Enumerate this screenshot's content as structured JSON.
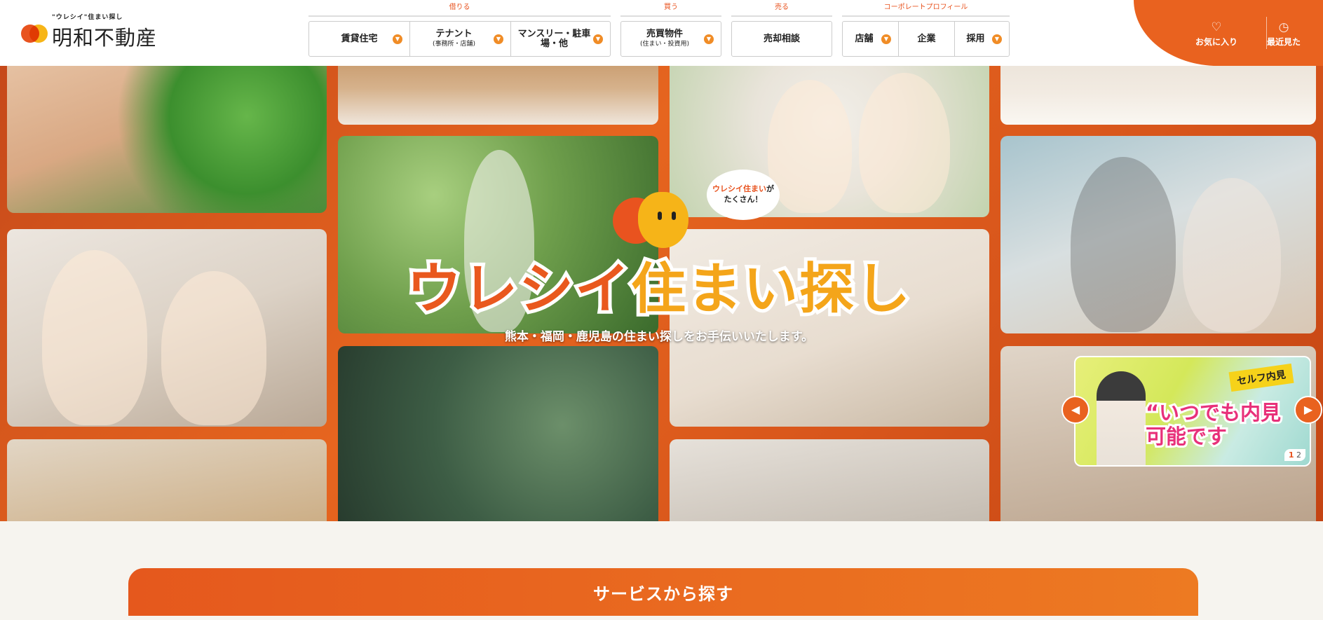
{
  "brand": {
    "tagline": "\"ウレシイ\"住まい探し",
    "name": "明和不動産",
    "accent": "#e9621f",
    "accent_yellow": "#f6b418"
  },
  "nav": [
    {
      "category": "借りる",
      "items": [
        {
          "label": "賃貸住宅",
          "sub": ""
        },
        {
          "label": "テナント",
          "sub": "(事務所・店舗)"
        },
        {
          "label": "マンスリー・駐車場・他",
          "sub": ""
        }
      ]
    },
    {
      "category": "買う",
      "items": [
        {
          "label": "売買物件",
          "sub": "(住まい・投資用)"
        }
      ]
    },
    {
      "category": "売る",
      "items": [
        {
          "label": "売却相談",
          "sub": ""
        }
      ]
    },
    {
      "category": "コーポレートプロフィール",
      "items": [
        {
          "label": "店舗",
          "sub": ""
        },
        {
          "label": "企業",
          "sub": ""
        },
        {
          "label": "採用",
          "sub": ""
        }
      ]
    }
  ],
  "corner": {
    "favorites": "お気に入り",
    "recent": "最近見た"
  },
  "hero": {
    "bubble_line1": "ウレシイ住まい",
    "bubble_suffix": "が",
    "bubble_line2": "たくさん！",
    "catch_orange": "ウレシイ",
    "catch_yellow": "住まい探し",
    "subcatch": "熊本・福岡・鹿児島の住まい探しをお手伝いいたします。"
  },
  "slider": {
    "tag": "セルフ内見",
    "headline": "“いつでも内見",
    "headline2": "可能です",
    "page_current": "1",
    "page_total": "2"
  },
  "services": {
    "title": "サービスから探す"
  }
}
